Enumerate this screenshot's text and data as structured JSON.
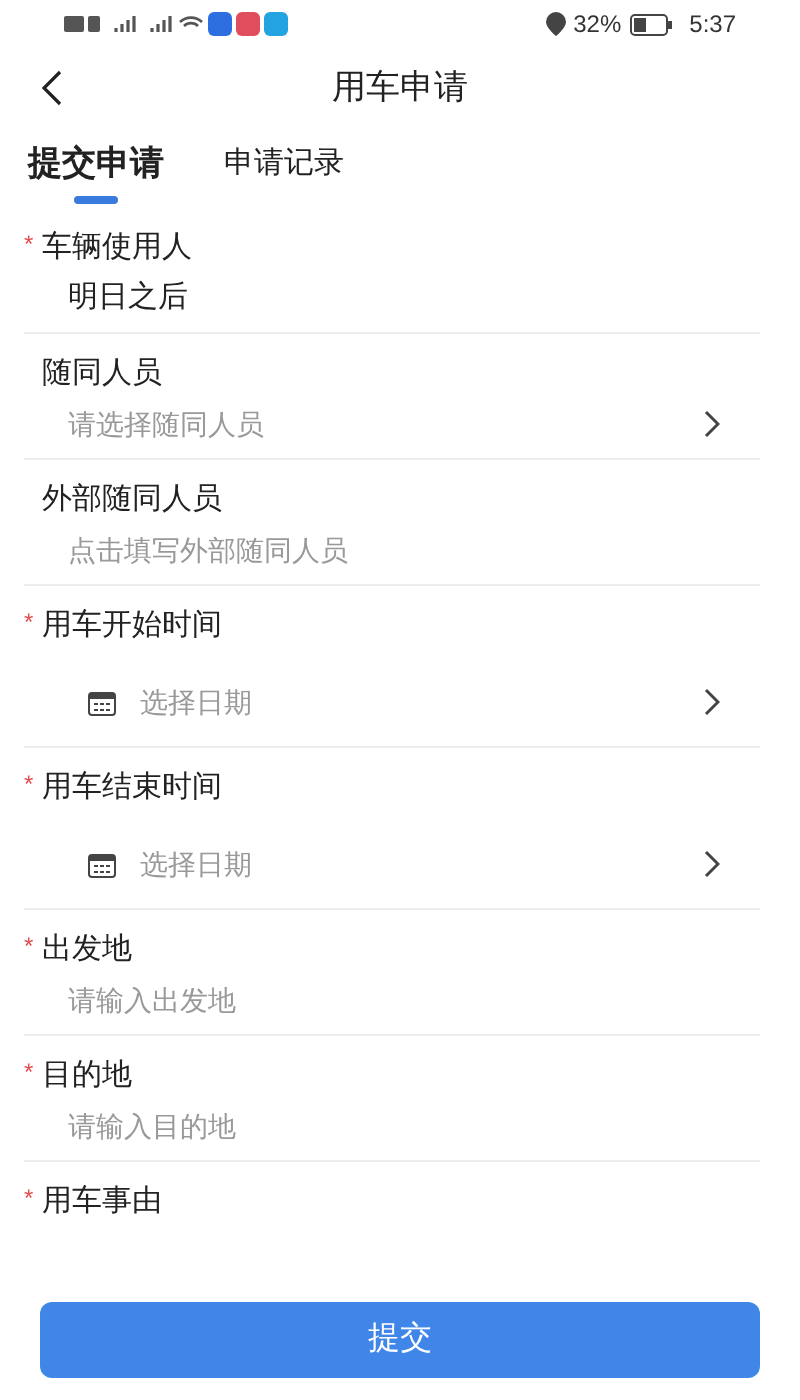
{
  "status_bar": {
    "battery": "32%",
    "time": "5:37"
  },
  "header": {
    "title": "用车申请"
  },
  "tabs": [
    {
      "label": "提交申请",
      "selected": true
    },
    {
      "label": "申请记录",
      "selected": false
    }
  ],
  "fields": [
    {
      "kind": "text",
      "label": "车辆使用人",
      "required_mark": "*",
      "value": "明日之后"
    },
    {
      "kind": "select",
      "label": "随同人员",
      "placeholder": "请选择随同人员"
    },
    {
      "kind": "input",
      "label": "外部随同人员",
      "placeholder": "点击填写外部随同人员"
    },
    {
      "kind": "date",
      "label": "用车开始时间",
      "required_mark": "*",
      "placeholder": "选择日期"
    },
    {
      "kind": "date",
      "label": "用车结束时间",
      "required_mark": "*",
      "placeholder": "选择日期"
    },
    {
      "kind": "input",
      "label": "出发地",
      "required_mark": "*",
      "placeholder": "请输入出发地"
    },
    {
      "kind": "input",
      "label": "目的地",
      "required_mark": "*",
      "placeholder": "请输入目的地"
    },
    {
      "kind": "label",
      "label": "用车事由",
      "required_mark": "*"
    }
  ],
  "submit_button": "提交"
}
